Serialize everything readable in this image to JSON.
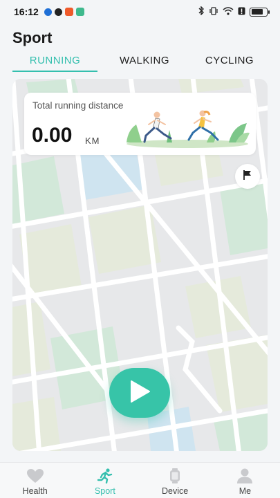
{
  "status_bar": {
    "time": "16:12",
    "app_icons": [
      "bluetooth-app-icon",
      "qq-icon",
      "orange-app-icon",
      "vpn-app-icon"
    ],
    "right_icons": [
      "bluetooth-icon",
      "vibrate-icon",
      "wifi-icon",
      "warning-icon",
      "battery-icon"
    ],
    "battery_level": 0.8
  },
  "page": {
    "title": "Sport"
  },
  "tabs": [
    {
      "label": "RUNNING",
      "active": true
    },
    {
      "label": "WALKING",
      "active": false
    },
    {
      "label": "CYCLING",
      "active": false
    }
  ],
  "distance_card": {
    "label": "Total running distance",
    "value": "0.00",
    "unit": "KM"
  },
  "controls": {
    "flag_icon": "flag-icon",
    "play_icon": "play-icon"
  },
  "bottom_nav": [
    {
      "label": "Health",
      "icon": "heart-icon",
      "active": false
    },
    {
      "label": "Sport",
      "icon": "runner-icon",
      "active": true
    },
    {
      "label": "Device",
      "icon": "watch-icon",
      "active": false
    },
    {
      "label": "Me",
      "icon": "person-icon",
      "active": false
    }
  ],
  "colors": {
    "accent": "#34bfae",
    "play_button": "#37c4a8",
    "map_background": "#e7e8ea",
    "map_block_green": "#d2e8d9",
    "map_block_olive": "#e5eadb",
    "map_block_blue": "#cfe4f0"
  }
}
